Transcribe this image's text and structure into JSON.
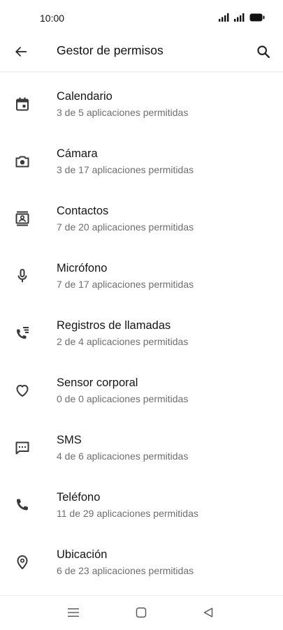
{
  "status_bar": {
    "time": "10:00",
    "icons": [
      "signal-icon",
      "signal-icon",
      "battery-icon"
    ]
  },
  "app_bar": {
    "title": "Gestor de permisos",
    "back_icon": "arrow-back-icon",
    "search_icon": "search-icon"
  },
  "permissions": [
    {
      "label": "Calendario",
      "summary": "3 de 5 aplicaciones permitidas",
      "icon": "calendar-icon"
    },
    {
      "label": "Cámara",
      "summary": "3 de 17 aplicaciones permitidas",
      "icon": "camera-icon"
    },
    {
      "label": "Contactos",
      "summary": "7 de 20 aplicaciones permitidas",
      "icon": "contacts-icon"
    },
    {
      "label": "Micrófono",
      "summary": "7 de 17 aplicaciones permitidas",
      "icon": "microphone-icon"
    },
    {
      "label": "Registros de llamadas",
      "summary": "2 de 4 aplicaciones permitidas",
      "icon": "call-log-icon"
    },
    {
      "label": "Sensor corporal",
      "summary": "0 de 0 aplicaciones permitidas",
      "icon": "heart-icon"
    },
    {
      "label": "SMS",
      "summary": "4 de 6 aplicaciones permitidas",
      "icon": "sms-icon"
    },
    {
      "label": "Teléfono",
      "summary": "11 de 29 aplicaciones permitidas",
      "icon": "phone-icon"
    },
    {
      "label": "Ubicación",
      "summary": "6 de 23 aplicaciones permitidas",
      "icon": "location-icon"
    }
  ],
  "nav_bar": {
    "icons": [
      "menu-icon",
      "home-icon",
      "back-icon"
    ]
  },
  "colors": {
    "icon": "#3a3a3a",
    "title_text": "#151515",
    "secondary_text": "#6e6e6e",
    "background": "#ffffff"
  }
}
